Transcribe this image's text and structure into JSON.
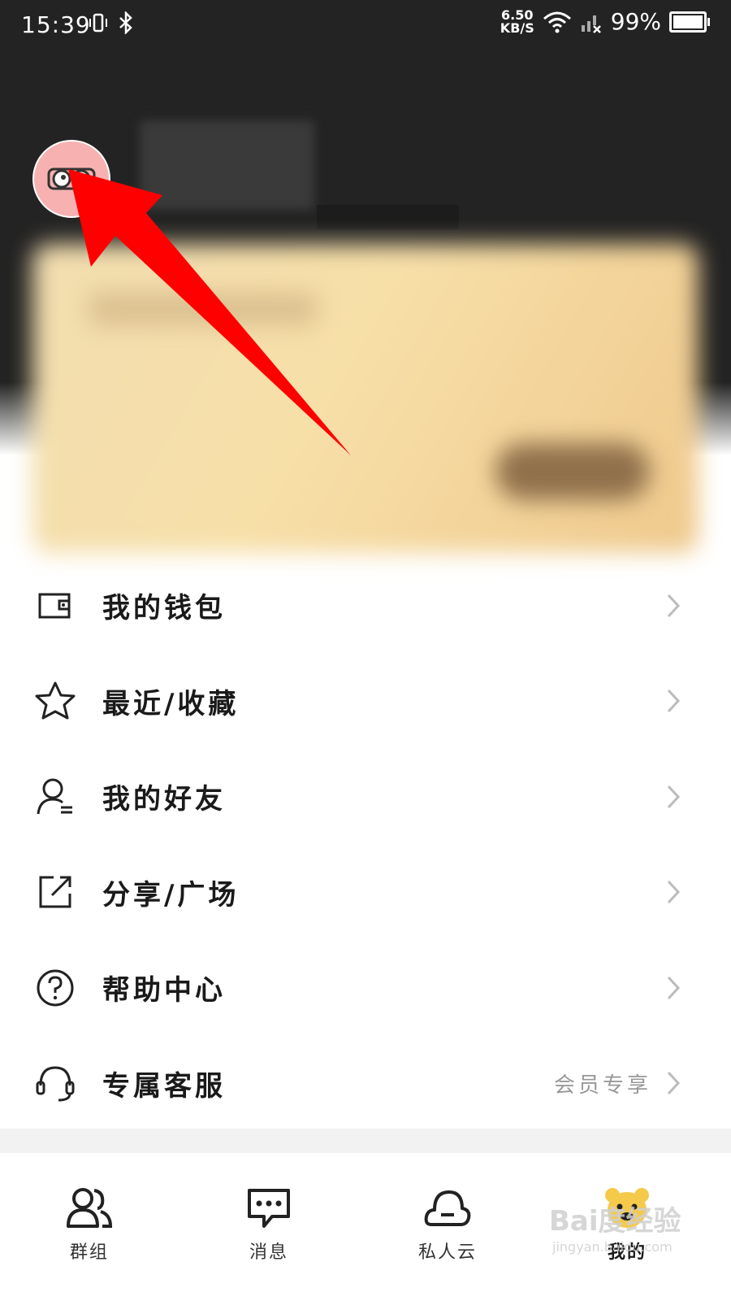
{
  "status_bar": {
    "time": "15:39",
    "net_speed_value": "6.50",
    "net_speed_unit": "KB/S",
    "battery": "99%"
  },
  "colors": {
    "header_bg": "#232323",
    "accent_yellow": "#f5c94a",
    "avatar_bg": "#f7b1b1",
    "arrow": "#ff0000"
  },
  "menu": {
    "items": [
      {
        "label": "我的钱包",
        "icon": "wallet-icon",
        "extra": ""
      },
      {
        "label": "最近/收藏",
        "icon": "star-icon",
        "extra": ""
      },
      {
        "label": "我的好友",
        "icon": "friends-icon",
        "extra": ""
      },
      {
        "label": "分享/广场",
        "icon": "share-icon",
        "extra": ""
      },
      {
        "label": "帮助中心",
        "icon": "help-icon",
        "extra": ""
      },
      {
        "label": "专属客服",
        "icon": "headset-icon",
        "extra": "会员专享"
      }
    ]
  },
  "bottom_nav": {
    "items": [
      {
        "label": "群组",
        "icon": "group-icon"
      },
      {
        "label": "消息",
        "icon": "message-icon"
      },
      {
        "label": "私人云",
        "icon": "cloud-icon"
      },
      {
        "label": "我的",
        "icon": "bear-icon",
        "active": true
      }
    ]
  },
  "watermark": {
    "text": "Bai度经验",
    "sub": "jingyan.baidu.com"
  }
}
